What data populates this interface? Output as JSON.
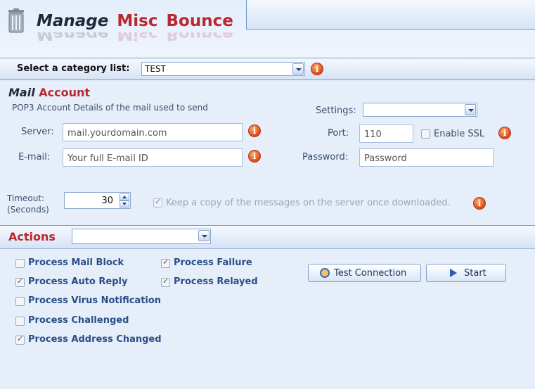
{
  "header": {
    "title_part1": "Manage",
    "title_part2": "Misc",
    "title_part3": "Bounce"
  },
  "category": {
    "label": "Select a category list:",
    "selected": "TEST"
  },
  "mail_account": {
    "title_part1": "Mail",
    "title_part2": "Account",
    "subtitle": "POP3 Account Details of the mail used to send",
    "server_label": "Server:",
    "server_placeholder": "mail.yourdomain.com",
    "email_label": "E-mail:",
    "email_placeholder": "Your full E-mail ID",
    "settings_label": "Settings:",
    "settings_value": "",
    "port_label": "Port:",
    "port_value": "110",
    "ssl_label": "Enable SSL",
    "ssl_checked": false,
    "password_label": "Password:",
    "password_placeholder": "Password",
    "timeout_label_1": "Timeout:",
    "timeout_label_2": "(Seconds)",
    "timeout_value": "30",
    "keep_copy_label": "Keep a copy of the messages on the server once downloaded.",
    "keep_copy_checked": true
  },
  "actions": {
    "title": "Actions",
    "dropdown_value": "",
    "options": [
      {
        "label": "Process Mail Block",
        "checked": false
      },
      {
        "label": "Process Failure",
        "checked": true
      },
      {
        "label": "Process Auto Reply",
        "checked": true
      },
      {
        "label": "Process Relayed",
        "checked": true
      },
      {
        "label": "Process Virus Notification",
        "checked": false
      },
      {
        "label": "Process Challenged",
        "checked": false
      },
      {
        "label": "Process Address Changed",
        "checked": true
      }
    ],
    "test_connection_label": "Test Connection",
    "start_label": "Start"
  },
  "icons": {
    "info": "info-icon",
    "trash": "trash-can-icon",
    "test_connection": "plug-icon",
    "start": "play-icon"
  },
  "colors": {
    "accent_red": "#b8282e",
    "dark_title": "#1e2a3c",
    "option_blue": "#2b4e88",
    "panel_bg": "#e5eef9"
  }
}
